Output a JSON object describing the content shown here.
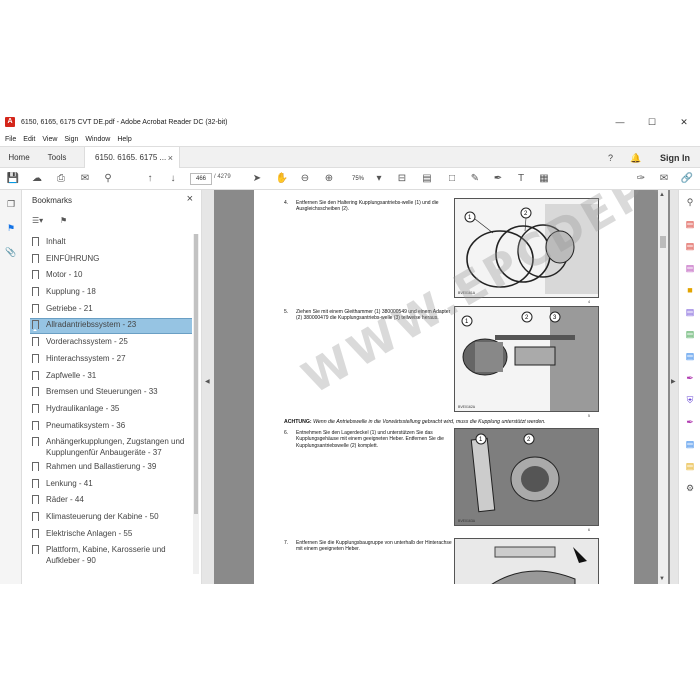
{
  "window": {
    "title": "6150, 6165, 6175 CVT DE.pdf - Adobe Acrobat Reader DC (32-bit)",
    "app_icon": "acrobat-icon",
    "controls": [
      "—",
      "☐",
      "✕"
    ]
  },
  "menu": [
    "File",
    "Edit",
    "View",
    "Sign",
    "Window",
    "Help"
  ],
  "tabs": {
    "home": "Home",
    "tools": "Tools",
    "doc": "6150. 6165. 6175 ...",
    "doc_close": "×",
    "sign_in": "Sign In"
  },
  "toolbar": {
    "page_current": "466",
    "page_total": "/ 4279",
    "zoom": "75%"
  },
  "bookmarks": {
    "header": "Bookmarks",
    "close": "×",
    "items": [
      {
        "label": "Inhalt"
      },
      {
        "label": "EINFÜHRUNG"
      },
      {
        "label": "Motor - 10"
      },
      {
        "label": "Kupplung - 18"
      },
      {
        "label": "Getriebe - 21"
      },
      {
        "label": "Allradantriebssystem - 23",
        "selected": true
      },
      {
        "label": "Vorderachssystem - 25"
      },
      {
        "label": "Hinterachssystem - 27"
      },
      {
        "label": "Zapfwelle - 31"
      },
      {
        "label": "Bremsen und Steuerungen - 33"
      },
      {
        "label": "Hydraulikanlage - 35"
      },
      {
        "label": "Pneumatiksystem - 36"
      },
      {
        "label": "Anhängerkupplungen, Zugstangen und Kupplungenfür Anbaugeräte - 37"
      },
      {
        "label": "Rahmen und Ballastierung - 39"
      },
      {
        "label": "Lenkung - 41"
      },
      {
        "label": "Räder - 44"
      },
      {
        "label": "Klimasteuerung der Kabine - 50"
      },
      {
        "label": "Elektrische Anlagen - 55"
      },
      {
        "label": "Plattform, Kabine, Karosserie und Aufkleber - 90"
      }
    ]
  },
  "document": {
    "steps": [
      {
        "num": "4.",
        "text": "Entfernen Sie den Haltering Kupplungsantriebs-welle (1) und die Ausgleichsscheiben (2)."
      },
      {
        "num": "5.",
        "text": "Ziehen Sie mit einem Gleithammer (1) 380000549 und einem Adapter (2) 380000479 die Kupplungsantriebs-welle (3) teilweise heraus."
      },
      {
        "num": "6.",
        "text": "Entnehmen Sie den Lagerdeckel (1) und unterstützen Sie das Kupplungsgehäuse mit einem geeigneten Heber. Entfernen Sie die Kupplungsantriebswelle (2) komplett."
      },
      {
        "num": "7.",
        "text": "Entfernen Sie die Kupplungsbaugruppe von unterhalb der Hinterachse mit einem geeigneten Heber."
      }
    ],
    "warning_label": "ACHTUNG:",
    "warning_text": "Wenn die Antriebswelle in die Vorwärtsstellung gebracht wird, muss die Kupplung unterstützt werden.",
    "figure_codes": [
      "BVE0161A",
      "BVE0162A",
      "BVE0163A"
    ],
    "figure_refs": [
      "4",
      "5",
      "6"
    ],
    "watermark": "WWW.EPCDEPO.COM"
  },
  "colors": {
    "accent": "#1473e6",
    "selection": "#96c4e3",
    "doc_background": "#8a8a8a"
  }
}
